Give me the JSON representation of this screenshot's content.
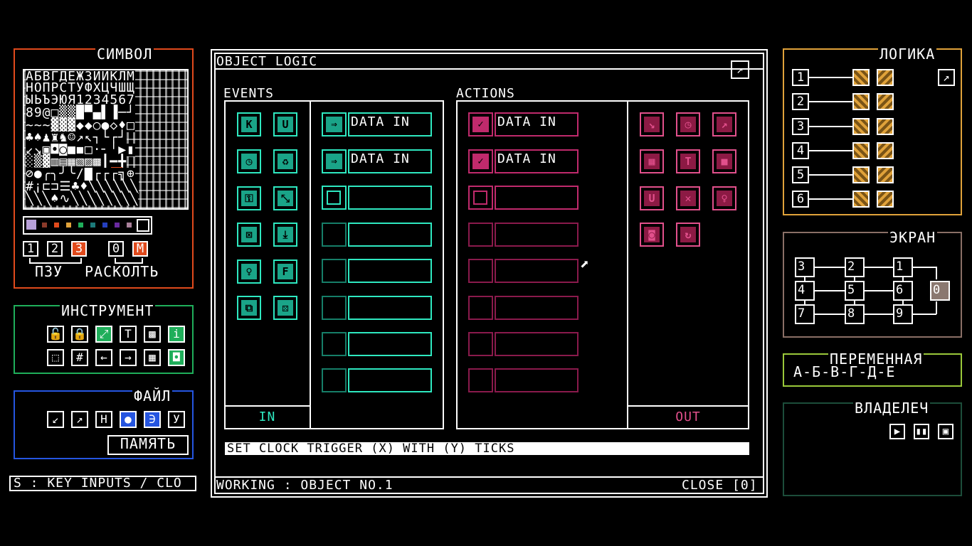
{
  "left": {
    "symbol_title": "СИМВОЛ",
    "glyph_rows": [
      "АБВГДЕЖЗИЙКЛМ",
      "НОПРСТУФХЦЧШЩ",
      "ЫЬЪЭЮЯ1234567",
      "89@□▒▒█▀▄▌▐─┘",
      "~~~▓▓▓◆◆○●◇♦□",
      "♣♠♟♜♞☺↗↖┐└┌┘",
      "↙↘▣◘◙■◼□·╴╵▶▮",
      "░▒▓▥▤▦▧▨▩┃━╋",
      "⊘●╭╮╯╰/▇┌┌┌╗⊕",
      "#¡⊏⊐☰♣♦╲╲╲╲╲╲",
      "╲╲╲♠∿╲╲╲╲╲╲╲╲"
    ],
    "palette_colors": [
      "#b7a0d8",
      "#8a3a2a",
      "#e04a1c",
      "#e0a23a",
      "#1fae5a",
      "#1c7a7a",
      "#2540c0",
      "#6a2aa0",
      "#a8809a",
      "#606060"
    ],
    "bank_buttons": [
      "1",
      "2",
      "3",
      "0",
      "M"
    ],
    "bank_label_ram": "ПЗУ",
    "bank_label_split": "РАСКОЛТЬ",
    "tool_title": "ИНСТРУМЕНТ",
    "tool_row1": [
      "🔓",
      "🔒",
      "⤢",
      "T",
      "▩",
      "i"
    ],
    "tool_row2": [
      "⬚",
      "#",
      "←",
      "→",
      "▦",
      "◘"
    ],
    "file_title": "ФАЙЛ",
    "file_buttons": [
      "↙",
      "↗",
      "Н",
      "●",
      "∋",
      "У"
    ],
    "memory_button": "ПАМЯТЬ",
    "status": "S : KEY INPUTS / CLO"
  },
  "window": {
    "title": "OBJECT LOGIC",
    "close_icon": "↗",
    "events_label": "EVENTS",
    "actions_label": "ACTIONS",
    "event_icons": [
      "K",
      "U",
      "◷",
      "♻",
      "⚿",
      "⤡",
      "⊠",
      "⤓",
      "♀",
      "F",
      "⧉",
      "⚄"
    ],
    "event_slots": [
      {
        "icon": "⇒",
        "text": "DATA IN"
      },
      {
        "icon": "⇒",
        "text": "DATA IN"
      },
      {
        "icon": "",
        "text": ""
      },
      {
        "icon": "",
        "text": ""
      },
      {
        "icon": "",
        "text": ""
      },
      {
        "icon": "",
        "text": ""
      },
      {
        "icon": "",
        "text": ""
      },
      {
        "icon": "",
        "text": ""
      }
    ],
    "in_label": "IN",
    "action_slots": [
      {
        "icon": "✓",
        "text": "DATA IN"
      },
      {
        "icon": "✓",
        "text": "DATA IN"
      },
      {
        "icon": "",
        "text": ""
      },
      {
        "icon": "",
        "text": ""
      },
      {
        "icon": "",
        "text": ""
      },
      {
        "icon": "",
        "text": ""
      },
      {
        "icon": "",
        "text": ""
      },
      {
        "icon": "",
        "text": ""
      }
    ],
    "action_icons": [
      "↘",
      "◷",
      "↗",
      "▦",
      "T",
      "■",
      "U",
      "✕",
      "♀",
      "◙",
      "↻"
    ],
    "out_label": "OUT",
    "hint": "SET CLOCK TRIGGER (X) WITH (Y) TICKS",
    "footer_left": "WORKING : OBJECT NO.1",
    "footer_right": "CLOSE [0]",
    "cursor": "⬈"
  },
  "right": {
    "logic_title": "ЛОГИКА",
    "logic_rows": [
      "1",
      "2",
      "3",
      "4",
      "5",
      "6"
    ],
    "logic_key_icon": "↗",
    "screen_title": "ЭКРАН",
    "screen_nodes": [
      "3",
      "2",
      "1",
      "4",
      "5",
      "6",
      "0",
      "7",
      "8",
      "9"
    ],
    "var_title": "ПЕРЕМЕННАЯ",
    "var_value": "А-Б-В-Г-Д-Е",
    "owner_title": "ВЛАДЕЛЕЧ",
    "owner_buttons": [
      "▶",
      "▮▮",
      "▣"
    ]
  }
}
